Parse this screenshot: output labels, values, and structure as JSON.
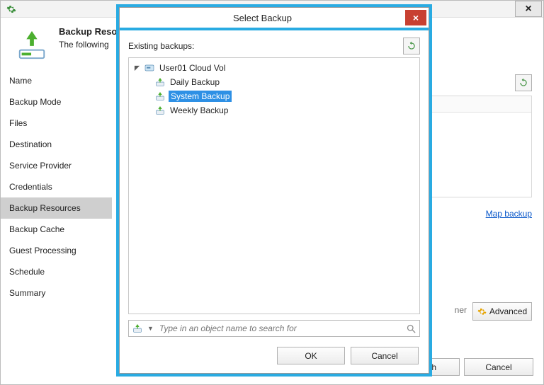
{
  "wizard": {
    "header_title": "Backup Resources",
    "header_sub": "The following ",
    "nav": [
      {
        "label": "Name"
      },
      {
        "label": "Backup Mode"
      },
      {
        "label": "Files"
      },
      {
        "label": "Destination"
      },
      {
        "label": "Service Provider"
      },
      {
        "label": "Credentials"
      },
      {
        "label": "Backup Resources",
        "active": true
      },
      {
        "label": "Backup Cache"
      },
      {
        "label": "Guest Processing"
      },
      {
        "label": "Schedule"
      },
      {
        "label": "Summary"
      }
    ],
    "map_link": "Map backup",
    "side_text": "ner",
    "advanced_label": "Advanced",
    "finish_label": "Finish",
    "cancel_label": "Cancel",
    "close_glyph": "×"
  },
  "modal": {
    "title": "Select Backup",
    "existing_label": "Existing backups:",
    "root_label": "User01 Cloud Vol",
    "children": [
      {
        "label": "Daily Backup",
        "selected": false
      },
      {
        "label": "System Backup",
        "selected": true
      },
      {
        "label": "Weekly Backup",
        "selected": false
      }
    ],
    "search_placeholder": "Type in an object name to search for",
    "ok_label": "OK",
    "cancel_label": "Cancel",
    "close_glyph": "×"
  },
  "colors": {
    "accent": "#29abe2",
    "selection": "#2e90e5",
    "danger": "#c84031",
    "link": "#0a58ca"
  }
}
